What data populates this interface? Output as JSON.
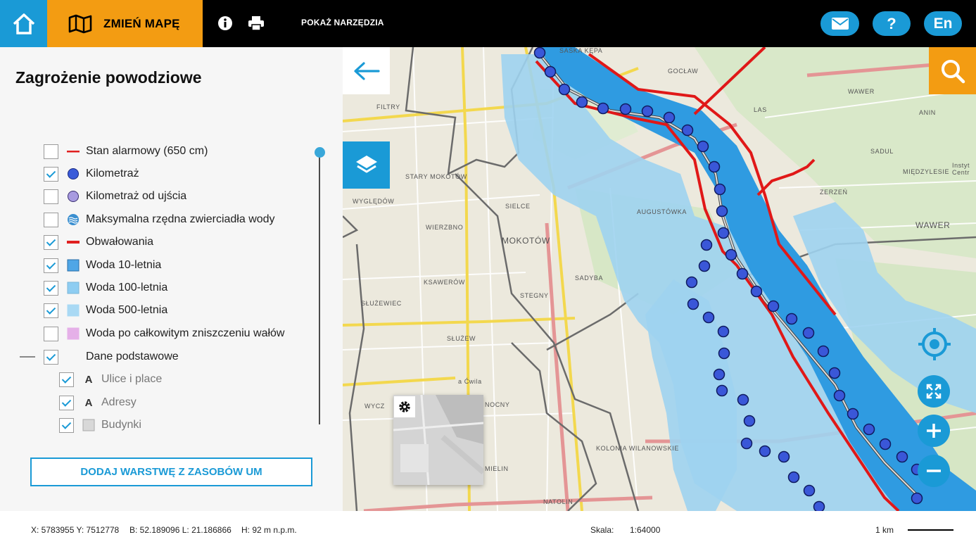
{
  "topbar": {
    "change_map_label": "ZMIEŃ MAPĘ",
    "show_tools_label": "POKAŻ NARZĘDZIA",
    "language_label": "En",
    "help_label": "?",
    "accent_color": "#1a9ad6",
    "orange_color": "#f39c12"
  },
  "panel": {
    "title": "Zagrożenie powodziowe",
    "layers": [
      {
        "label": "Stan alarmowy (650 cm)",
        "checked": false,
        "symbol": "red-line"
      },
      {
        "label": "Kilometraż",
        "checked": true,
        "symbol": "blue-dot"
      },
      {
        "label": "Kilometraż od ujścia",
        "checked": false,
        "symbol": "purple-dot"
      },
      {
        "label": "Maksymalna rzędna zwierciadła wody",
        "checked": false,
        "symbol": "water-icon"
      },
      {
        "label": "Obwałowania",
        "checked": true,
        "symbol": "red-thick-line"
      },
      {
        "label": "Woda 10-letnia",
        "checked": true,
        "symbol": "blue-square"
      },
      {
        "label": "Woda 100-letnia",
        "checked": true,
        "symbol": "light-blue-square"
      },
      {
        "label": "Woda 500-letnia",
        "checked": true,
        "symbol": "lighter-blue-square"
      },
      {
        "label": "Woda po całkowitym zniszczeniu wałów",
        "checked": false,
        "symbol": "pink-square"
      },
      {
        "label": "Dane podstawowe",
        "checked": true,
        "symbol": "none"
      }
    ],
    "sublayers": [
      {
        "label": "Ulice i place",
        "checked": true,
        "symbol": "A"
      },
      {
        "label": "Adresy",
        "checked": true,
        "symbol": "A"
      },
      {
        "label": "Budynki",
        "checked": true,
        "symbol": "gray-square"
      }
    ],
    "add_layer_label": "DODAJ WARSTWĘ Z ZASOBÓW UM"
  },
  "map": {
    "place_labels": [
      "SASKA KĘPA",
      "GOCŁAW",
      "WAWER",
      "LAS",
      "ANIN",
      "FILTRY",
      "STARY MOKOTÓW",
      "SADUL",
      "MIĘDZYLESIE",
      "ZERZEŃ",
      "WYGLĘDÓW",
      "SIELCE",
      "AUGUSTÓWKA",
      "WAWER",
      "WIERZBNO",
      "MOKOTÓW",
      "SADYBA",
      "KSAWERÓW",
      "STEGNY",
      "SŁUŻEWIEC",
      "SŁUŻEW",
      "WYCZ",
      "NOCNY",
      "KOLONIA WILANOWSKIE",
      "MIELIN",
      "NATOLIN",
      "a Ćwila",
      "Instyt Centr"
    ]
  },
  "status": {
    "xy": "X: 5783955 Y: 7512778",
    "bl": "B: 52.189096 L: 21.186866",
    "h": "H: 92 m n.p.m.",
    "scale_label": "Skala:",
    "scale_value": "1:64000",
    "scale_bar_label": "1 km"
  }
}
